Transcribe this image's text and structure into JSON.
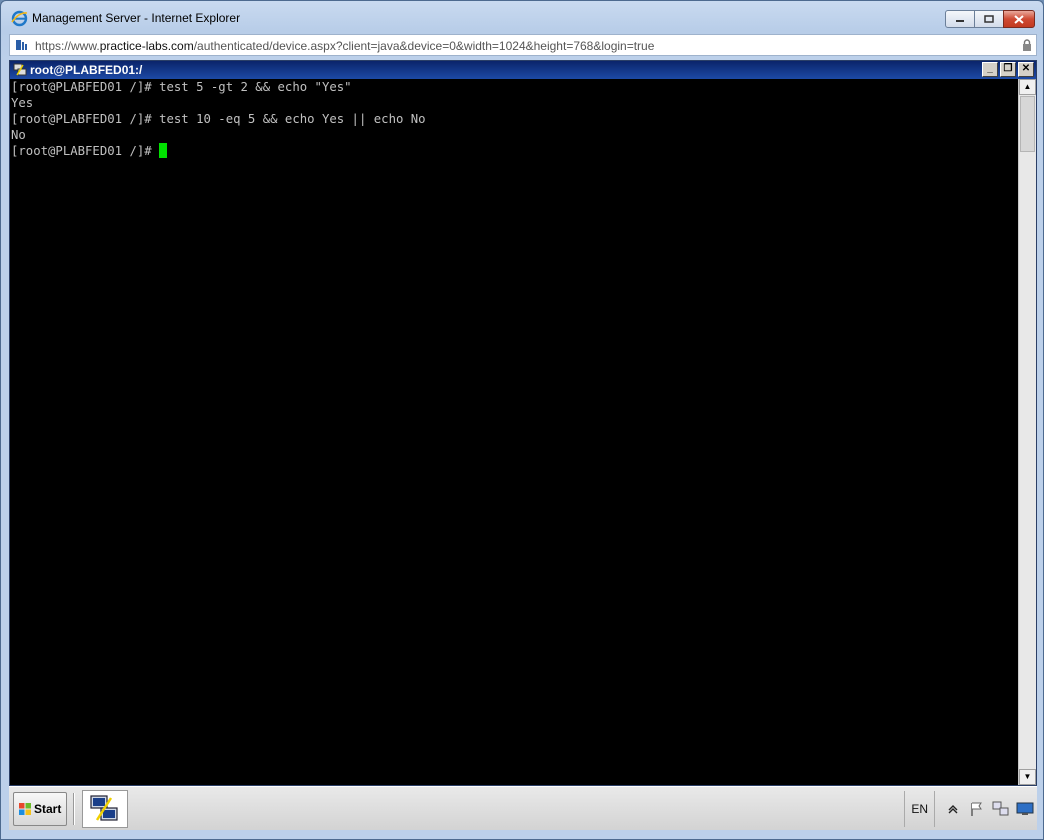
{
  "browser": {
    "title": "Management Server - Internet Explorer",
    "url_prefix": "https://www.",
    "url_host": "practice-labs.com",
    "url_path": "/authenticated/device.aspx?client=java&device=0&width=1024&height=768&login=true",
    "controls": {
      "minimize": "▭",
      "restore": "❐",
      "close": "✕"
    }
  },
  "terminal": {
    "title": "root@PLABFED01:/",
    "lines": [
      "[root@PLABFED01 /]# test 5 -gt 2 && echo \"Yes\"",
      "Yes",
      "[root@PLABFED01 /]# test 10 -eq 5 && echo Yes || echo No",
      "No",
      "[root@PLABFED01 /]# "
    ],
    "cursor_color": "#00e000",
    "controls": {
      "minimize": "_",
      "restore": "❐",
      "close": "✕"
    }
  },
  "taskbar": {
    "start_label": "Start",
    "language": "EN",
    "tray_icons": [
      "chevron-up-icon",
      "flag-icon",
      "network-icon",
      "monitor-icon"
    ]
  }
}
